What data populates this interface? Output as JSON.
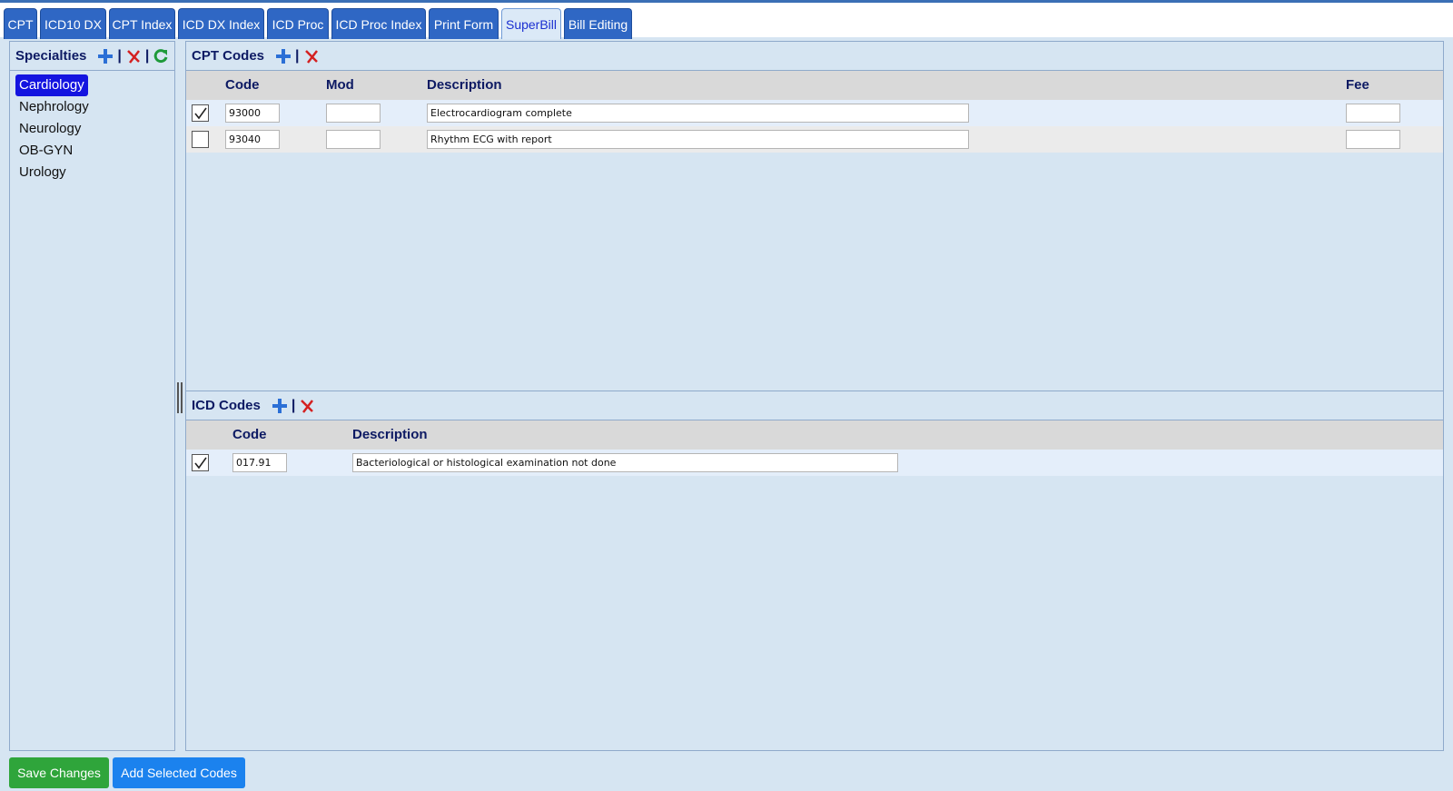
{
  "tabs": [
    {
      "label": "CPT"
    },
    {
      "label": "ICD10 DX"
    },
    {
      "label": "CPT Index"
    },
    {
      "label": "ICD DX Index"
    },
    {
      "label": "ICD Proc"
    },
    {
      "label": "ICD Proc Index"
    },
    {
      "label": "Print Form"
    },
    {
      "label": "SuperBill",
      "active": true
    },
    {
      "label": "Bill Editing"
    }
  ],
  "specialties": {
    "title": "Specialties",
    "items": [
      {
        "label": "Cardiology",
        "selected": true
      },
      {
        "label": "Nephrology"
      },
      {
        "label": "Neurology"
      },
      {
        "label": "OB-GYN"
      },
      {
        "label": "Urology"
      }
    ]
  },
  "cpt": {
    "title": "CPT Codes",
    "headers": {
      "code": "Code",
      "mod": "Mod",
      "description": "Description",
      "fee": "Fee"
    },
    "rows": [
      {
        "checked": true,
        "code": "93000",
        "mod": "",
        "description": "Electrocardiogram complete",
        "fee": ""
      },
      {
        "checked": false,
        "code": "93040",
        "mod": "",
        "description": "Rhythm ECG with report",
        "fee": ""
      }
    ]
  },
  "icd": {
    "title": "ICD Codes",
    "headers": {
      "code": "Code",
      "description": "Description"
    },
    "rows": [
      {
        "checked": true,
        "code": "017.91",
        "description": "Bacteriological or histological examination not done"
      }
    ]
  },
  "buttons": {
    "save": "Save Changes",
    "add": "Add Selected Codes"
  },
  "colors": {
    "tab": "#2f67c4",
    "selected": "#1414e0",
    "save": "#2fa53b",
    "add": "#1b82ee",
    "header": "#0d1a63"
  }
}
